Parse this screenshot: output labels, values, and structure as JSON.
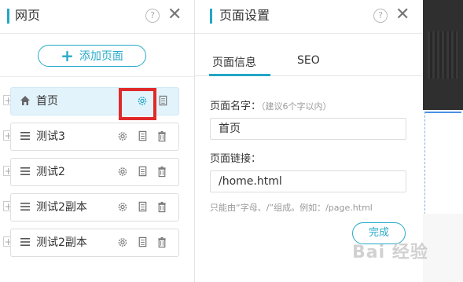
{
  "left_panel": {
    "title": "网页",
    "help_glyph": "?",
    "close_glyph": "✕",
    "add_button": {
      "plus": "+",
      "label": "添加页面"
    },
    "pages": [
      {
        "label": "首页",
        "icon": "home-icon",
        "active": true
      },
      {
        "label": "测试3",
        "icon": "menu-icon",
        "active": false
      },
      {
        "label": "测试2",
        "icon": "menu-icon",
        "active": false
      },
      {
        "label": "测试2副本",
        "icon": "menu-icon",
        "active": false
      },
      {
        "label": "测试2副本",
        "icon": "menu-icon",
        "active": false
      }
    ],
    "expand_glyph": "+"
  },
  "right_panel": {
    "title": "页面设置",
    "help_glyph": "?",
    "close_glyph": "✕",
    "tabs": [
      {
        "label": "页面信息",
        "active": true
      },
      {
        "label": "SEO",
        "active": false
      }
    ],
    "name_label": "页面名字：",
    "name_hint": "（建议6个字以内）",
    "name_value": "首页",
    "link_label": "页面链接：",
    "link_value": "/home.html",
    "note": "只能由“字母、/”组成。例如：/page.html",
    "done_label": "完成"
  },
  "watermark": "Bai 经验",
  "colors": {
    "accent": "#22a6c6",
    "highlight": "#e02a2a",
    "active_row": "#e3f3fb"
  }
}
